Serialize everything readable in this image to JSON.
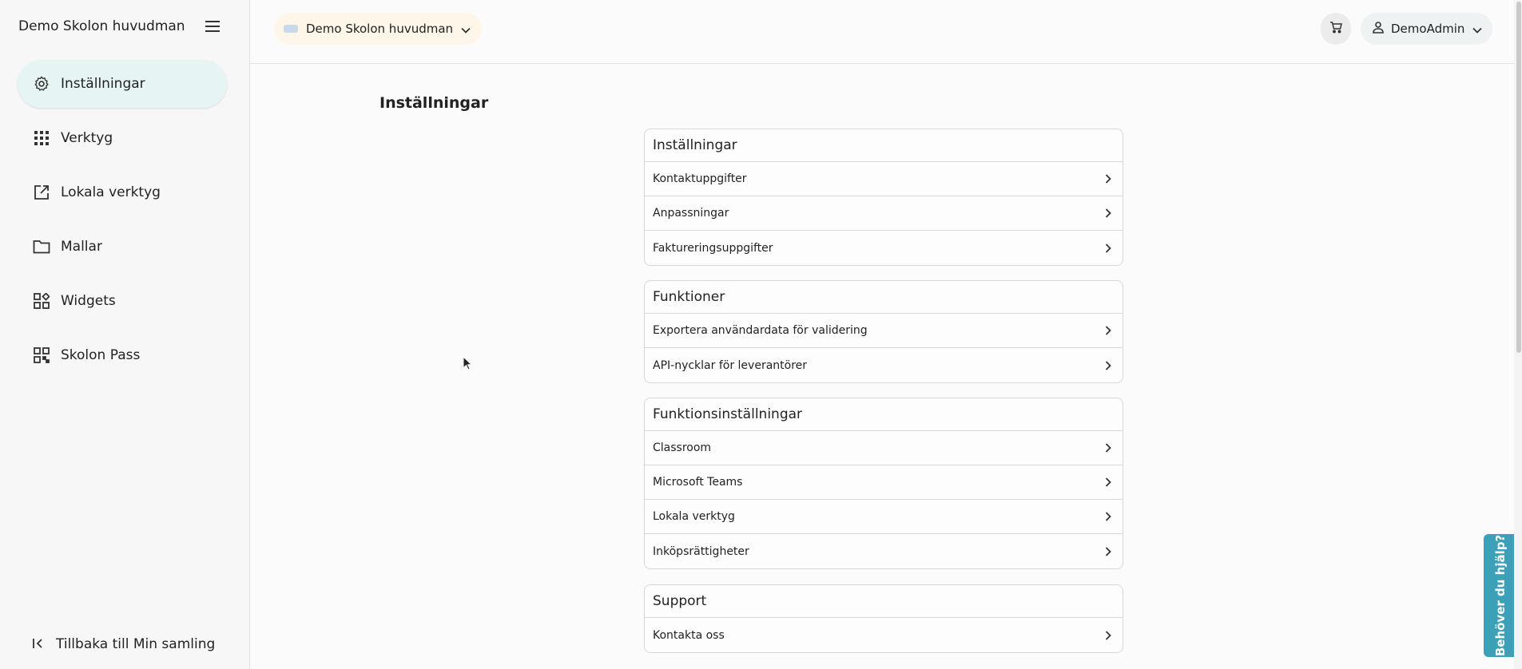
{
  "sidebar": {
    "org_title": "Demo Skolon huvudman",
    "items": [
      {
        "label": "Inställningar",
        "icon": "gear-icon",
        "active": true
      },
      {
        "label": "Verktyg",
        "icon": "apps-grid-icon",
        "active": false
      },
      {
        "label": "Lokala verktyg",
        "icon": "external-link-icon",
        "active": false
      },
      {
        "label": "Mallar",
        "icon": "folder-icon",
        "active": false
      },
      {
        "label": "Widgets",
        "icon": "widgets-icon",
        "active": false
      },
      {
        "label": "Skolon Pass",
        "icon": "qr-code-icon",
        "active": false
      }
    ],
    "back_label": "Tillbaka till Min samling"
  },
  "topbar": {
    "org_switch_label": "Demo Skolon huvudman",
    "user_label": "DemoAdmin"
  },
  "main": {
    "page_title": "Inställningar",
    "sections": [
      {
        "title": "Inställningar",
        "rows": [
          "Kontaktuppgifter",
          "Anpassningar",
          "Faktureringsuppgifter"
        ]
      },
      {
        "title": "Funktioner",
        "rows": [
          "Exportera användardata för validering",
          "API-nycklar för leverantörer"
        ]
      },
      {
        "title": "Funktionsinställningar",
        "rows": [
          "Classroom",
          "Microsoft Teams",
          "Lokala verktyg",
          "Inköpsrättigheter"
        ]
      },
      {
        "title": "Support",
        "rows": [
          "Kontakta oss"
        ]
      }
    ]
  },
  "help_tab": {
    "label": "Behöver du hjälp?"
  },
  "colors": {
    "accent": "#3ba0b8",
    "active_nav_bg": "#e6f5f4",
    "org_switch_bg": "#fdf6e9"
  }
}
